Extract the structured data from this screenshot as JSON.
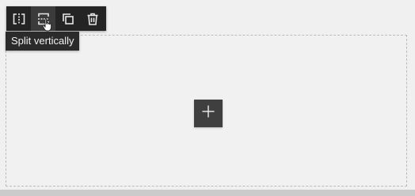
{
  "toolbar": {
    "buttons": [
      {
        "icon": "split-horizontal-icon"
      },
      {
        "icon": "split-vertical-icon"
      },
      {
        "icon": "duplicate-icon"
      },
      {
        "icon": "delete-icon"
      }
    ]
  },
  "tooltip": {
    "text": "Split vertically"
  },
  "canvas": {
    "add_icon": "plus-icon"
  },
  "colors": {
    "toolbar_bg": "#242424",
    "active_button_bg": "#3b3b3b",
    "canvas_border": "#b5bcc2",
    "add_button_bg": "#3f3f3f"
  }
}
